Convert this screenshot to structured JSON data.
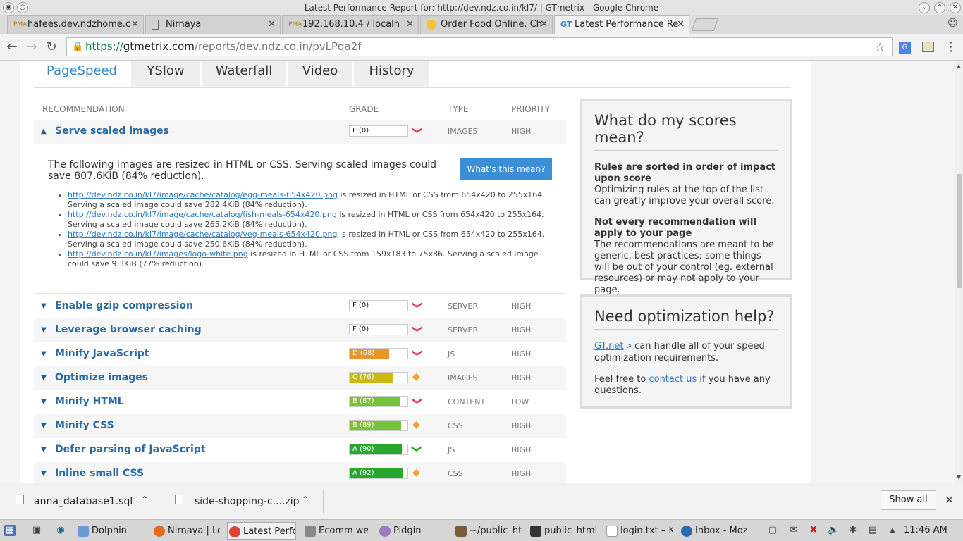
{
  "window": {
    "title": "Latest Performance Report for: http://dev.ndz.co.in/kl7/ | GTmetrix - Google Chrome"
  },
  "tabs": [
    {
      "label": "hafees.dev.ndzhome.c",
      "icon": "PMA",
      "active": false
    },
    {
      "label": "Nirnaya",
      "icon": "doc",
      "active": false
    },
    {
      "label": "192.168.10.4 / localh",
      "icon": "PMA",
      "active": false
    },
    {
      "label": "Order Food Online. Ch",
      "icon": "food",
      "active": false
    },
    {
      "label": "Latest Performance Re",
      "icon": "GT",
      "active": true
    }
  ],
  "address": {
    "scheme": "https://",
    "host": "gtmetrix.com",
    "path": "/reports/dev.ndz.co.in/pvLPqa2f"
  },
  "report_tabs": [
    "PageSpeed",
    "YSlow",
    "Waterfall",
    "Video",
    "History"
  ],
  "table": {
    "headers": {
      "recommendation": "RECOMMENDATION",
      "grade": "GRADE",
      "type": "TYPE",
      "priority": "PRIORITY"
    },
    "expanded": {
      "name": "Serve scaled images",
      "grade": "F (0)",
      "grade_pct": 0,
      "type": "IMAGES",
      "priority": "HIGH",
      "intro": "The following images are resized in HTML or CSS. Serving scaled images could save 807.6KiB (84% reduction).",
      "button": "What's this mean?",
      "items": [
        {
          "link": "http://dev.ndz.co.in/kl7/image/cache/catalog/egg-meals-654x420.png",
          "text": " is resized in HTML or CSS from 654x420 to 255x164. Serving a scaled image could save 282.4KiB (84% reduction)."
        },
        {
          "link": "http://dev.ndz.co.in/kl7/image/cache/catalog/fish-meals-654x420.png",
          "text": " is resized in HTML or CSS from 654x420 to 255x164. Serving a scaled image could save 265.2KiB (84% reduction)."
        },
        {
          "link": "http://dev.ndz.co.in/kl7/image/cache/catalog/veg-meals-654x420.png",
          "text": " is resized in HTML or CSS from 654x420 to 255x164. Serving a scaled image could save 250.6KiB (84% reduction)."
        },
        {
          "link": "http://dev.ndz.co.in/kl7/images/logo-white.png",
          "text": " is resized in HTML or CSS from 159x183 to 75x86. Serving a scaled image could save 9.3KiB (77% reduction)."
        }
      ]
    },
    "rows": [
      {
        "name": "Enable gzip compression",
        "grade": "F (0)",
        "grade_pct": 0,
        "color": "#ffffff",
        "trend": "down",
        "type": "SERVER",
        "priority": "HIGH"
      },
      {
        "name": "Leverage browser caching",
        "grade": "F (0)",
        "grade_pct": 0,
        "color": "#ffffff",
        "trend": "down",
        "type": "SERVER",
        "priority": "HIGH"
      },
      {
        "name": "Minify JavaScript",
        "grade": "D (68)",
        "grade_pct": 68,
        "color": "#e8962a",
        "trend": "down",
        "type": "JS",
        "priority": "HIGH"
      },
      {
        "name": "Optimize images",
        "grade": "C (76)",
        "grade_pct": 76,
        "color": "#cbb812",
        "trend": "neutral",
        "type": "IMAGES",
        "priority": "HIGH"
      },
      {
        "name": "Minify HTML",
        "grade": "B (87)",
        "grade_pct": 87,
        "color": "#7ac13a",
        "trend": "down",
        "type": "CONTENT",
        "priority": "LOW"
      },
      {
        "name": "Minify CSS",
        "grade": "B (89)",
        "grade_pct": 89,
        "color": "#7ac13a",
        "trend": "neutral",
        "type": "CSS",
        "priority": "HIGH"
      },
      {
        "name": "Defer parsing of JavaScript",
        "grade": "A (90)",
        "grade_pct": 90,
        "color": "#27a72b",
        "trend": "up",
        "type": "JS",
        "priority": "HIGH"
      },
      {
        "name": "Inline small CSS",
        "grade": "A (92)",
        "grade_pct": 92,
        "color": "#27a72b",
        "trend": "neutral",
        "type": "CSS",
        "priority": "HIGH"
      }
    ]
  },
  "sidebar": {
    "scores": {
      "title": "What do my scores mean?",
      "p1_bold": "Rules are sorted in order of impact upon score",
      "p1": "Optimizing rules at the top of the list can greatly improve your overall score.",
      "p2_bold": "Not every recommendation will apply to your page",
      "p2": "The recommendations are meant to be generic, best practices; some things will be out of your control (eg. external resources) or may not apply to your page."
    },
    "help": {
      "title": "Need optimization help?",
      "link1": "GT.net",
      "p1": " can handle all of your speed optimization requirements.",
      "p2_pre": "Feel free to ",
      "link2": "contact us",
      "p2_post": " if you have any questions."
    }
  },
  "downloads": {
    "file1": "anna_database1.sql",
    "file2": "side-shopping-c....zip",
    "show_all": "Show all"
  },
  "taskbar": {
    "items": [
      "Dolphin",
      "Nirnaya | Lo",
      "Latest Perfo",
      "Ecomm web",
      "Pidgin",
      "~/public_htr",
      "public_html",
      "login.txt – K",
      "Inbox - Mozi"
    ],
    "clock": "11:46 AM"
  }
}
